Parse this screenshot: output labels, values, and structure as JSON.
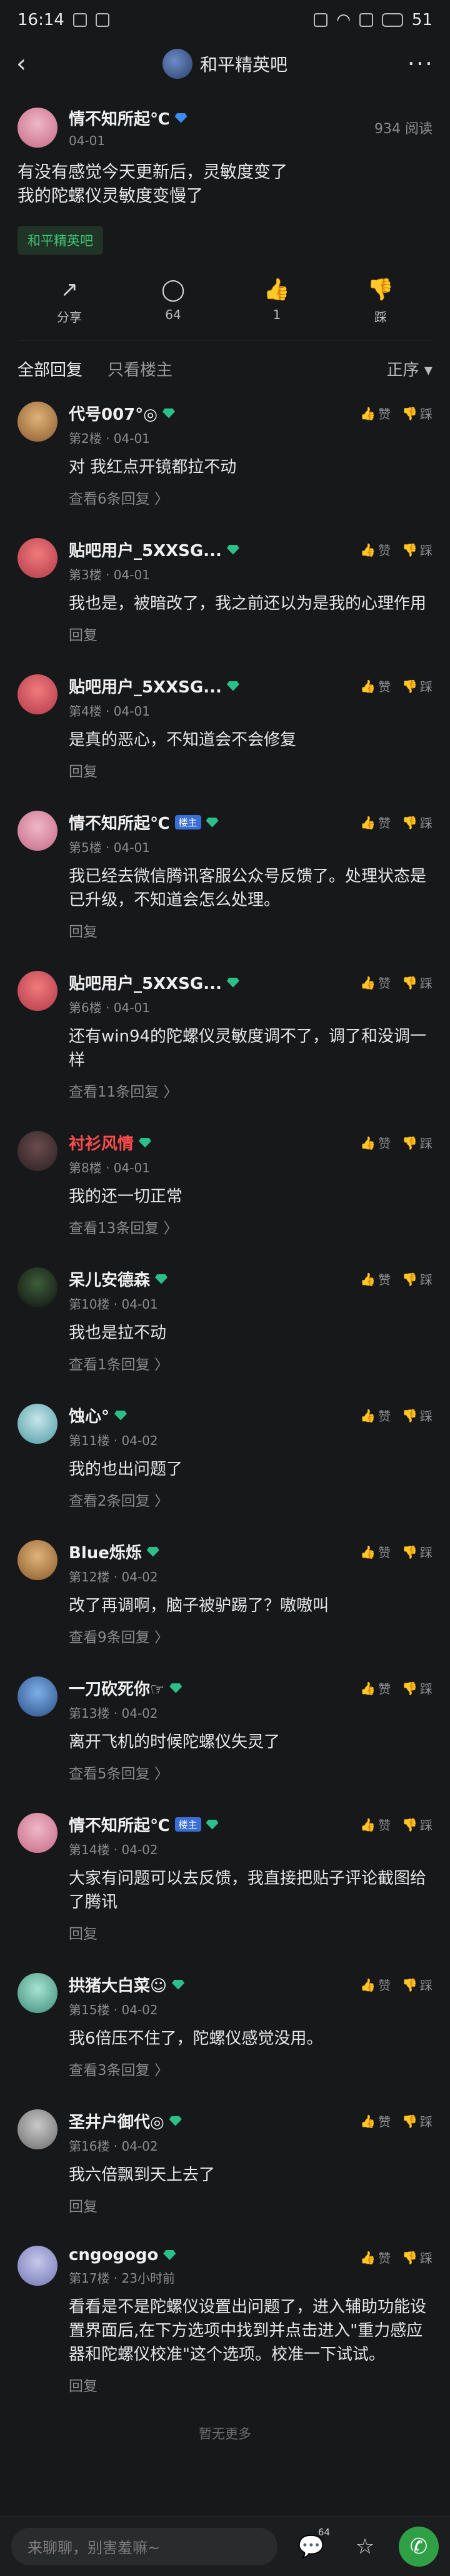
{
  "status": {
    "time": "16:14",
    "battery": "51"
  },
  "nav": {
    "back": "‹",
    "title": "和平精英吧",
    "more": "···"
  },
  "post": {
    "author": "情不知所起℃",
    "date": "04-01",
    "reads": "934 阅读",
    "title_line1": "有没有感觉今天更新后，灵敏度变了",
    "title_line2": "我的陀螺仪灵敏度变慢了",
    "tag": "和平精英吧"
  },
  "actions": {
    "share": "分享",
    "comments": "64",
    "likes": "1",
    "dislike": "踩"
  },
  "filter": {
    "all": "全部回复",
    "only_author": "只看楼主",
    "sort": "正序 ▾"
  },
  "reply_ops": {
    "like": "赞",
    "dislike": "踩"
  },
  "replies": [
    {
      "name": "代号007°◎",
      "floor": "第2楼 · 04-01",
      "text": "对 我红点开镜都拉不动",
      "sub": "查看6条回复 〉"
    },
    {
      "name": "贴吧用户_5XXSG...",
      "floor": "第3楼 · 04-01",
      "text": "我也是，被暗改了，我之前还以为是我的心理作用",
      "sub": "回复"
    },
    {
      "name": "贴吧用户_5XXSG...",
      "floor": "第4楼 · 04-01",
      "text": "是真的恶心，不知道会不会修复",
      "sub": "回复"
    },
    {
      "name": "情不知所起℃",
      "lz": "楼主",
      "floor": "第5楼 · 04-01",
      "text": "我已经去微信腾讯客服公众号反馈了。处理状态是已升级，不知道会怎么处理。",
      "sub": "回复"
    },
    {
      "name": "贴吧用户_5XXSG...",
      "floor": "第6楼 · 04-01",
      "text": "还有win94的陀螺仪灵敏度调不了，调了和没调一样",
      "sub": "查看11条回复 〉"
    },
    {
      "name": "衬衫风情",
      "floor": "第8楼 · 04-01",
      "text": "我的还一切正常",
      "sub": "查看13条回复 〉"
    },
    {
      "name": "呆儿安德森",
      "floor": "第10楼 · 04-01",
      "text": "我也是拉不动",
      "sub": "查看1条回复 〉"
    },
    {
      "name": "蚀心°",
      "floor": "第11楼 · 04-02",
      "text": "我的也出问题了",
      "sub": "查看2条回复 〉"
    },
    {
      "name": "Blue烁烁",
      "floor": "第12楼 · 04-02",
      "text": "改了再调啊，脑子被驴踢了？嗷嗷叫",
      "sub": "查看9条回复 〉"
    },
    {
      "name": "一刀砍死你☞",
      "floor": "第13楼 · 04-02",
      "text": "离开飞机的时候陀螺仪失灵了",
      "sub": "查看5条回复 〉"
    },
    {
      "name": "情不知所起℃",
      "lz": "楼主",
      "floor": "第14楼 · 04-02",
      "text": "大家有问题可以去反馈，我直接把贴子评论截图给了腾讯",
      "sub": "回复"
    },
    {
      "name": "拱猪大白菜☺",
      "floor": "第15楼 · 04-02",
      "text": "我6倍压不住了，陀螺仪感觉没用。",
      "sub": "查看3条回复 〉"
    },
    {
      "name": "圣井户御代◎",
      "floor": "第16楼 · 04-02",
      "text": "我六倍飘到天上去了",
      "sub": "回复"
    },
    {
      "name": "cngogogo",
      "floor": "第17楼 · 23小时前",
      "text": "看看是不是陀螺仪设置出问题了，进入辅助功能设置界面后,在下方选项中找到并点击进入\"重力感应器和陀螺仪校准\"这个选项。校准一下试试。",
      "sub": "回复"
    }
  ],
  "end_note": "暂无更多",
  "bottom": {
    "placeholder": "来聊聊，别害羞嘛~",
    "comment_count": "64"
  }
}
